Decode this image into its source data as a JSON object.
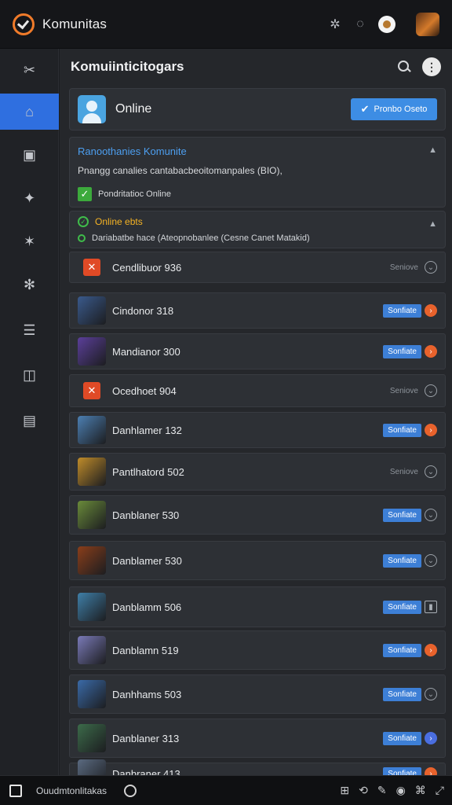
{
  "app": {
    "title": "Komunitas"
  },
  "main": {
    "title": "Komuiinticitogars"
  },
  "status_card": {
    "label": "Online",
    "button_label": "Pronbo Oseto"
  },
  "info_card": {
    "title": "Ranoothanies Komunite",
    "description": "Pnangg canalies cantabacbeoitomanpales (BIO),",
    "check_label": "Pondritatioc Online"
  },
  "online_card": {
    "title": "Online ebts",
    "description": "Dariabatbe hace (Ateopnobanlee (Cesne Canet Matakid)"
  },
  "rows": [
    {
      "name": "Cendlibuor 936",
      "status": "Seniove",
      "badge": "",
      "icon": "chevron-circle-icon",
      "thumb": "red",
      "thumb_color": "#e04a26"
    },
    {
      "name": "Cindonor 318",
      "status": "",
      "badge": "Sonfiate",
      "icon": "orange-circle-icon",
      "thumb": "game",
      "thumb_color": "#3a5a8c"
    },
    {
      "name": "Mandianor 300",
      "status": "",
      "badge": "Sonfiate",
      "icon": "orange-circle-icon",
      "thumb": "game",
      "thumb_color": "#5b3f9a"
    },
    {
      "name": "Ocedhoet 904",
      "status": "Seniove",
      "badge": "",
      "icon": "chevron-circle-icon",
      "thumb": "red",
      "thumb_color": "#e04a26"
    },
    {
      "name": "Danhlamer 132",
      "status": "",
      "badge": "Sonfiate",
      "icon": "orange-circle-icon",
      "thumb": "game",
      "thumb_color": "#4c7fb2"
    },
    {
      "name": "Pantlhatord 502",
      "status": "Seniove",
      "badge": "",
      "icon": "chevron-circle-icon",
      "thumb": "game",
      "thumb_color": "#c08c2a"
    },
    {
      "name": "Danblaner 530",
      "status": "",
      "badge": "Sonfiate",
      "icon": "grey-circle-icon",
      "thumb": "game",
      "thumb_color": "#6a8b3a"
    },
    {
      "name": "Danblamer 530",
      "status": "",
      "badge": "Sonfiate",
      "icon": "grey-circle-icon",
      "thumb": "game",
      "thumb_color": "#8a3e1a"
    },
    {
      "name": "Danblamm 506",
      "status": "",
      "badge": "Sonfiate",
      "icon": "square-icon",
      "thumb": "game",
      "thumb_color": "#3f7fa8"
    },
    {
      "name": "Danblamn 519",
      "status": "",
      "badge": "Sonfiate",
      "icon": "orange-circle-icon",
      "thumb": "game",
      "thumb_color": "#7a7ab8"
    },
    {
      "name": "Danhhams 503",
      "status": "",
      "badge": "Sonfiate",
      "icon": "grey-circle-icon",
      "thumb": "game",
      "thumb_color": "#3a6aa8"
    },
    {
      "name": "Danblaner 313",
      "status": "",
      "badge": "Sonfiate",
      "icon": "blue-circle-icon",
      "thumb": "game",
      "thumb_color": "#3c6b4a"
    },
    {
      "name": "Danbraner 413",
      "status": "",
      "badge": "Sonfiate",
      "icon": "orange-circle-icon",
      "thumb": "game",
      "thumb_color": "#5a6a80"
    }
  ],
  "taskbar": {
    "label": "Ouudmtonlitakas"
  },
  "colors": {
    "accent": "#2f6fe0",
    "badge": "#3d7fd6",
    "orange": "#e8622c",
    "online_title": "#f5b324",
    "info_title": "#4d9ff0"
  }
}
